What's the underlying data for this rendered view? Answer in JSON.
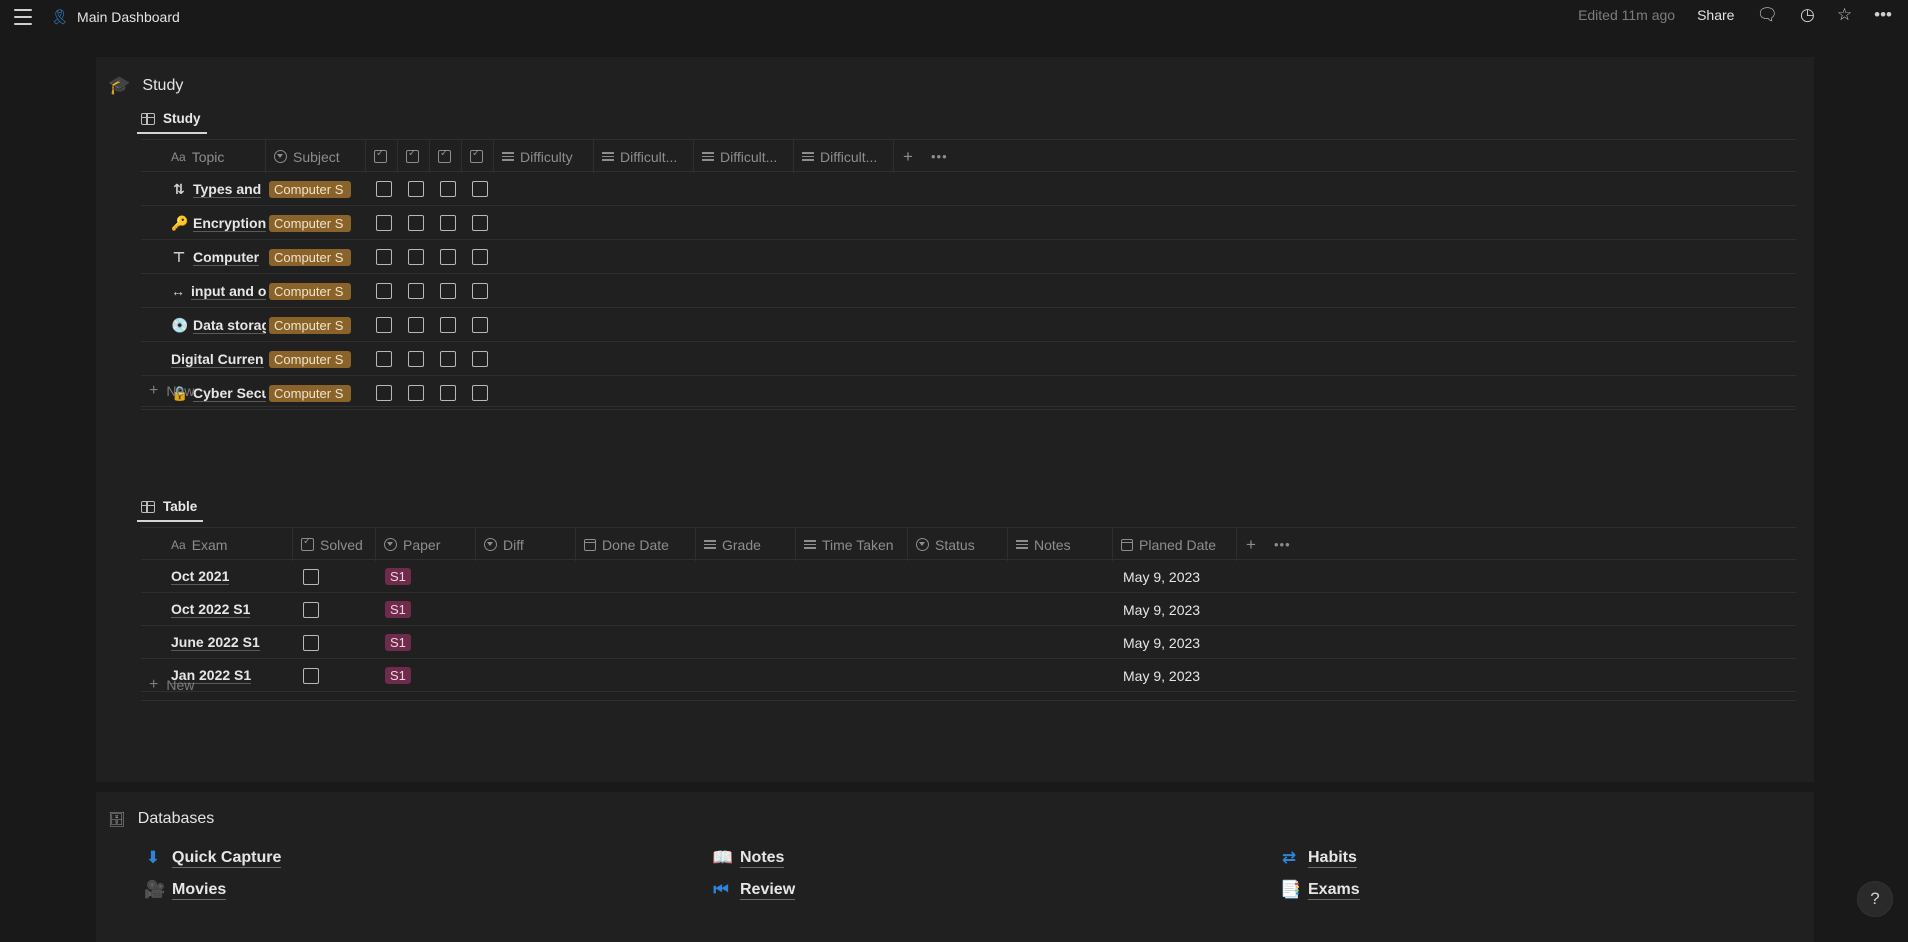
{
  "topbar": {
    "page_title": "Main Dashboard",
    "edited": "Edited 11m ago",
    "share": "Share"
  },
  "study_section": {
    "title": "Study",
    "view_tab": "Study",
    "columns": [
      "Topic",
      "Subject",
      "",
      "",
      "",
      "",
      "Difficulty",
      "Difficult...",
      "Difficult...",
      "Difficult..."
    ],
    "rows": [
      {
        "icon": "⇅",
        "icon_name": "sort-arrows-icon",
        "topic": "Types and",
        "subject": "Computer S"
      },
      {
        "icon": "🔑",
        "icon_name": "key-icon",
        "topic": "Encryption",
        "subject": "Computer S"
      },
      {
        "icon": "⊤",
        "icon_name": "network-icon",
        "topic": "Computer",
        "subject": "Computer S"
      },
      {
        "icon": "↔",
        "icon_name": "left-right-arrow-icon",
        "topic": "input and o",
        "subject": "Computer S"
      },
      {
        "icon": "💿",
        "icon_name": "disc-icon",
        "topic": "Data storag",
        "subject": "Computer S"
      },
      {
        "icon": "",
        "icon_name": "",
        "topic": "Digital Curren",
        "subject": "Computer S"
      },
      {
        "icon": "🔒",
        "icon_name": "lock-icon",
        "topic": "Cyber Secu",
        "subject": "Computer S"
      }
    ],
    "new_label": "New"
  },
  "exam_section": {
    "view_tab": "Table",
    "columns": [
      "Exam",
      "Solved",
      "Paper",
      "Diff",
      "Done Date",
      "Grade",
      "Time Taken",
      "Status",
      "Notes",
      "Planed Date"
    ],
    "rows": [
      {
        "exam": "Oct 2021",
        "paper": "S1",
        "planned": "May 9, 2023"
      },
      {
        "exam": "Oct 2022 S1",
        "paper": "S1",
        "planned": "May 9, 2023"
      },
      {
        "exam": "June 2022 S1",
        "paper": "S1",
        "planned": "May 9, 2023"
      },
      {
        "exam": "Jan 2022 S1",
        "paper": "S1",
        "planned": "May 9, 2023"
      }
    ],
    "new_label": "New"
  },
  "databases": {
    "title": "Databases",
    "links": [
      {
        "label": "Quick Capture",
        "icon": "⬇",
        "icon_name": "download-circle-icon"
      },
      {
        "label": "Notes",
        "icon": "📖",
        "icon_name": "book-icon"
      },
      {
        "label": "Habits",
        "icon": "⇄",
        "icon_name": "repeat-icon"
      },
      {
        "label": "Movies",
        "icon": "🎥",
        "icon_name": "movie-camera-icon"
      },
      {
        "label": "Review",
        "icon": "⏮",
        "icon_name": "rewind-icon"
      },
      {
        "label": "Exams",
        "icon": "📑",
        "icon_name": "documents-icon"
      }
    ]
  },
  "help": "?"
}
